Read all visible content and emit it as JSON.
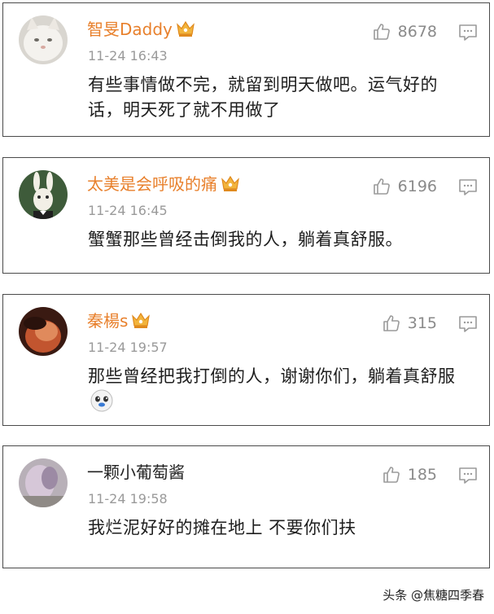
{
  "comments": [
    {
      "username": "智旻Daddy",
      "vip": true,
      "timestamp": "11-24 16:43",
      "text": "有些事情做不完，就留到明天做吧。运气好的话，明天死了就不用做了",
      "likes": "8678"
    },
    {
      "username": "太美是会呼吸的痛",
      "vip": true,
      "timestamp": "11-24 16:45",
      "text": "蟹蟹那些曾经击倒我的人，躺着真舒服。",
      "likes": "6196"
    },
    {
      "username": "秦楊s",
      "vip": true,
      "timestamp": "11-24 19:57",
      "text": "那些曾经把我打倒的人，谢谢你们，躺着真舒服",
      "likes": "315"
    },
    {
      "username": "一颗小葡萄酱",
      "vip": false,
      "timestamp": "11-24 19:58",
      "text": "我烂泥好好的摊在地上 不要你们扶",
      "likes": "185"
    }
  ],
  "icons": {
    "like": "thumbs-up-icon",
    "reply": "comment-icon",
    "vip": "crown-badge-icon",
    "emoji": "doge-emoji-icon"
  },
  "colors": {
    "username_vip": "#e8802c",
    "timestamp": "#9a9a9a",
    "icon": "#9a9a9a"
  },
  "watermark": "头条 @焦糖四季春"
}
